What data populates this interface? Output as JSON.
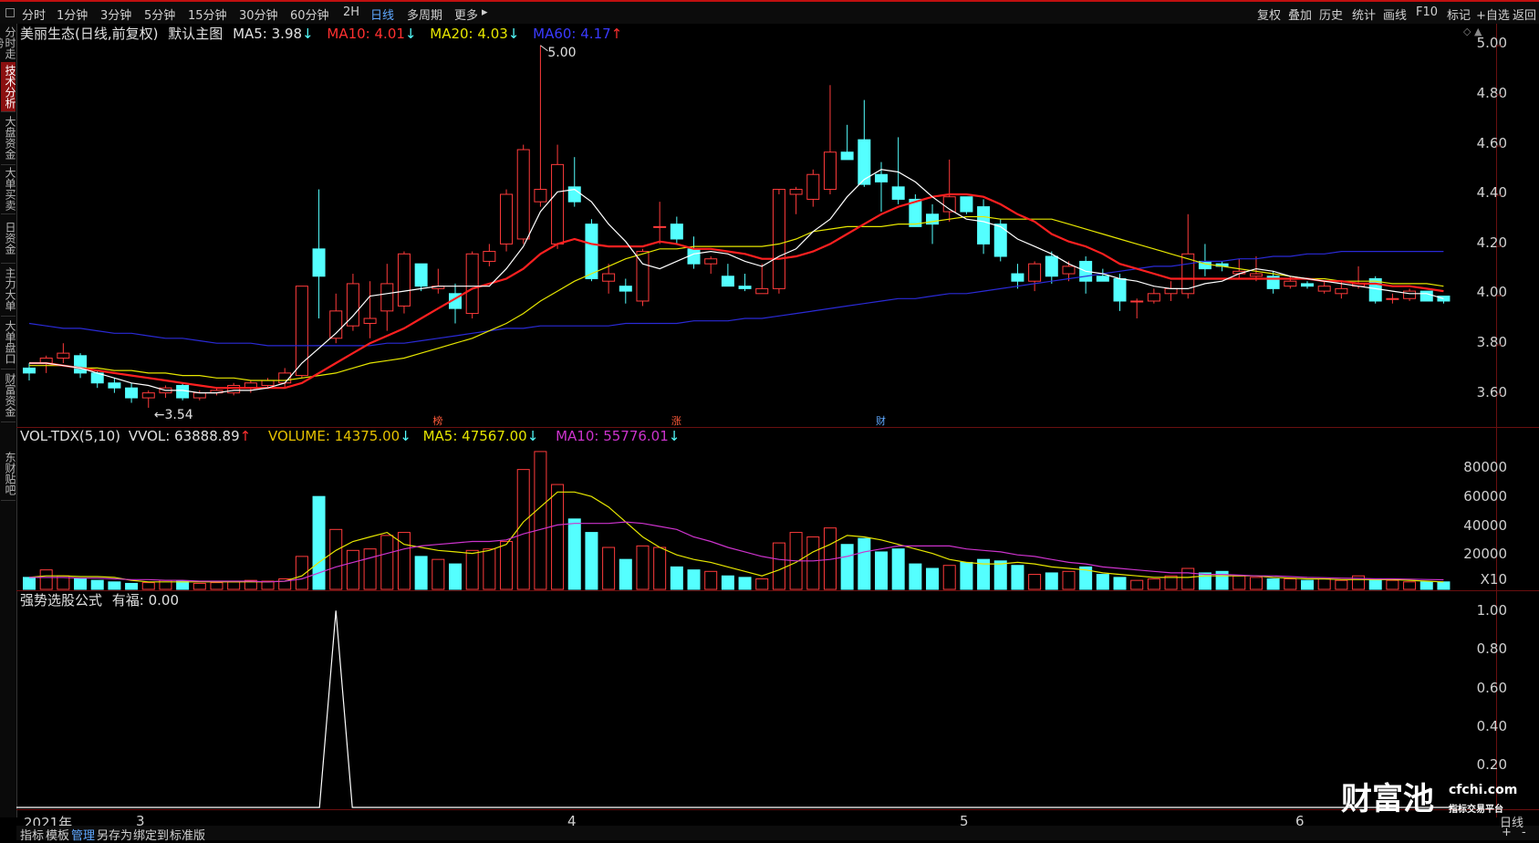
{
  "toolbar": {
    "periods": [
      "分时",
      "1分钟",
      "3分钟",
      "5分钟",
      "15分钟",
      "30分钟",
      "60分钟",
      "2H",
      "日线",
      "多周期",
      "更多"
    ],
    "more_arrow": "▸",
    "active_period": "日线",
    "right_tools": [
      "复权",
      "叠加",
      "历史",
      "统计",
      "画线",
      "F10",
      "标记",
      "+自选",
      "返回"
    ]
  },
  "left_tabs": [
    "分时走势",
    "技术分析",
    "大盘资金",
    "大单买卖",
    "日资金",
    "主力大单",
    "大单盘口",
    "财富资金",
    "东财贴吧"
  ],
  "active_left_tab": "技术分析",
  "main_panel": {
    "stock": "美丽生态(日线,前复权)",
    "indicator": "默认主图",
    "ma5": "MA5: 3.98",
    "ma5_arrow": "↓",
    "ma10": "MA10: 4.01",
    "ma10_arrow": "↓",
    "ma20": "MA20: 4.03",
    "ma20_arrow": "↓",
    "ma60": "MA60: 4.17",
    "ma60_arrow": "↑",
    "controls": "◇ ▲",
    "price_axis": [
      "5.00",
      "4.80",
      "4.60",
      "4.40",
      "4.20",
      "4.00",
      "3.80",
      "3.60"
    ],
    "high_annotation": "5.00",
    "low_annotation": "3.54",
    "markers": [
      "榜",
      "涨",
      "财"
    ]
  },
  "volume_panel": {
    "indicator": "VOL-TDX(5,10)",
    "vvol": "VVOL: 63888.89",
    "vvol_arrow": "↑",
    "volume": "VOLUME: 14375.00",
    "volume_arrow": "↓",
    "ma5": "MA5: 47567.00",
    "ma5_arrow": "↓",
    "ma10": "MA10: 55776.01",
    "ma10_arrow": "↓",
    "axis": [
      "80000",
      "60000",
      "40000",
      "20000"
    ],
    "unit": "X10"
  },
  "signal_panel": {
    "indicator": "强势选股公式",
    "value": "有福: 0.00",
    "axis": [
      "1.00",
      "0.80",
      "0.60",
      "0.40",
      "0.20"
    ]
  },
  "dates": [
    "2021年",
    "3",
    "4",
    "5",
    "6"
  ],
  "bottom_bar": {
    "items": [
      "指标",
      "模板",
      "管理",
      "另存为",
      "绑定到",
      "标准版"
    ],
    "active": "管理",
    "period": "日线",
    "zoom": [
      "+",
      "-"
    ]
  },
  "watermark": {
    "brand": "财富池",
    "site": "cfchi.com",
    "tagline": "指标交易平台"
  },
  "colors": {
    "up": "#ff3b3b",
    "down": "#54ffff",
    "ma5": "#ffffff",
    "ma10": "#ff2020",
    "ma20": "#e6e600",
    "ma60": "#2a2ad6",
    "vol_ma10": "#cc33cc",
    "grid_border": "#6a0f0f"
  },
  "chart_data": [
    {
      "type": "candlestick",
      "title": "美丽生态(日线,前复权)",
      "ylim": [
        3.47,
        5.08
      ],
      "candles": [
        [
          3.7,
          3.72,
          3.65,
          3.68
        ],
        [
          3.72,
          3.75,
          3.68,
          3.74
        ],
        [
          3.74,
          3.8,
          3.72,
          3.76
        ],
        [
          3.75,
          3.76,
          3.66,
          3.68
        ],
        [
          3.68,
          3.69,
          3.62,
          3.64
        ],
        [
          3.64,
          3.66,
          3.6,
          3.62
        ],
        [
          3.62,
          3.64,
          3.56,
          3.58
        ],
        [
          3.58,
          3.61,
          3.54,
          3.6
        ],
        [
          3.6,
          3.63,
          3.58,
          3.62
        ],
        [
          3.63,
          3.64,
          3.57,
          3.58
        ],
        [
          3.58,
          3.61,
          3.57,
          3.6
        ],
        [
          3.6,
          3.62,
          3.59,
          3.61
        ],
        [
          3.6,
          3.64,
          3.59,
          3.63
        ],
        [
          3.62,
          3.65,
          3.6,
          3.64
        ],
        [
          3.63,
          3.66,
          3.62,
          3.65
        ],
        [
          3.64,
          3.7,
          3.62,
          3.68
        ],
        [
          3.67,
          4.03,
          3.66,
          4.03
        ],
        [
          4.18,
          4.42,
          3.9,
          4.07
        ],
        [
          3.82,
          4.0,
          3.8,
          3.93
        ],
        [
          3.87,
          4.08,
          3.85,
          4.04
        ],
        [
          3.88,
          4.05,
          3.82,
          3.9
        ],
        [
          3.93,
          4.12,
          3.85,
          4.04
        ],
        [
          3.95,
          4.17,
          3.92,
          4.16
        ],
        [
          4.12,
          4.12,
          4.01,
          4.03
        ],
        [
          4.02,
          4.1,
          4.0,
          4.03
        ],
        [
          4.0,
          4.04,
          3.88,
          3.94
        ],
        [
          3.92,
          4.17,
          3.9,
          4.16
        ],
        [
          4.13,
          4.2,
          4.11,
          4.17
        ],
        [
          4.2,
          4.42,
          4.17,
          4.4
        ],
        [
          4.22,
          4.6,
          4.2,
          4.58
        ],
        [
          4.37,
          5.0,
          4.35,
          4.42
        ],
        [
          4.2,
          4.6,
          4.18,
          4.52
        ],
        [
          4.43,
          4.55,
          4.35,
          4.37
        ],
        [
          4.28,
          4.3,
          4.05,
          4.06
        ],
        [
          4.05,
          4.12,
          4.0,
          4.08
        ],
        [
          4.03,
          4.06,
          3.96,
          4.01
        ],
        [
          3.97,
          4.18,
          3.95,
          4.17
        ],
        [
          4.27,
          4.37,
          4.2,
          4.27
        ],
        [
          4.28,
          4.31,
          4.2,
          4.22
        ],
        [
          4.18,
          4.23,
          4.1,
          4.12
        ],
        [
          4.12,
          4.15,
          4.08,
          4.14
        ],
        [
          4.07,
          4.12,
          4.03,
          4.03
        ],
        [
          4.03,
          4.08,
          4.01,
          4.02
        ],
        [
          4.0,
          4.12,
          4.0,
          4.02
        ],
        [
          4.02,
          4.4,
          4.0,
          4.42
        ],
        [
          4.4,
          4.43,
          4.32,
          4.42
        ],
        [
          4.38,
          4.5,
          4.35,
          4.48
        ],
        [
          4.42,
          4.84,
          4.4,
          4.57
        ],
        [
          4.57,
          4.68,
          4.55,
          4.54
        ],
        [
          4.62,
          4.78,
          4.43,
          4.44
        ],
        [
          4.48,
          4.53,
          4.33,
          4.45
        ],
        [
          4.43,
          4.63,
          4.36,
          4.38
        ],
        [
          4.38,
          4.4,
          4.28,
          4.27
        ],
        [
          4.32,
          4.36,
          4.2,
          4.28
        ],
        [
          4.33,
          4.54,
          4.29,
          4.39
        ],
        [
          4.39,
          4.38,
          4.32,
          4.33
        ],
        [
          4.35,
          4.38,
          4.16,
          4.2
        ],
        [
          4.28,
          4.3,
          4.13,
          4.15
        ],
        [
          4.08,
          4.12,
          4.02,
          4.05
        ],
        [
          4.05,
          4.13,
          4.01,
          4.12
        ],
        [
          4.15,
          4.17,
          4.04,
          4.07
        ],
        [
          4.08,
          4.13,
          4.05,
          4.11
        ],
        [
          4.13,
          4.15,
          4.0,
          4.05
        ],
        [
          4.07,
          4.1,
          4.05,
          4.05
        ],
        [
          4.06,
          4.08,
          3.93,
          3.97
        ],
        [
          3.97,
          3.98,
          3.9,
          3.97
        ],
        [
          3.97,
          4.02,
          3.96,
          4.0
        ],
        [
          4.0,
          4.05,
          3.97,
          4.02
        ],
        [
          4.0,
          4.32,
          3.98,
          4.16
        ],
        [
          4.13,
          4.2,
          4.07,
          4.1
        ],
        [
          4.12,
          4.13,
          4.09,
          4.11
        ],
        [
          4.08,
          4.14,
          4.06,
          4.09
        ],
        [
          4.07,
          4.15,
          4.05,
          4.08
        ],
        [
          4.07,
          4.09,
          4.0,
          4.02
        ],
        [
          4.03,
          4.07,
          4.02,
          4.05
        ],
        [
          4.04,
          4.05,
          4.02,
          4.03
        ],
        [
          4.01,
          4.05,
          4.0,
          4.03
        ],
        [
          4.0,
          4.05,
          3.98,
          4.02
        ],
        [
          4.03,
          4.11,
          4.02,
          4.04
        ],
        [
          4.06,
          4.07,
          3.96,
          3.97
        ],
        [
          3.98,
          4.0,
          3.96,
          3.98
        ],
        [
          3.98,
          4.02,
          3.97,
          4.01
        ],
        [
          4.01,
          4.01,
          3.97,
          3.97
        ],
        [
          3.99,
          3.99,
          3.96,
          3.97
        ]
      ],
      "ma5": [
        3.72,
        3.72,
        3.71,
        3.7,
        3.68,
        3.66,
        3.64,
        3.63,
        3.61,
        3.61,
        3.6,
        3.6,
        3.61,
        3.61,
        3.62,
        3.64,
        3.72,
        3.78,
        3.84,
        3.91,
        3.99,
        4.0,
        4.01,
        4.02,
        4.03,
        4.03,
        4.03,
        4.03,
        4.1,
        4.19,
        4.33,
        4.41,
        4.42,
        4.37,
        4.28,
        4.21,
        4.12,
        4.1,
        4.13,
        4.16,
        4.17,
        4.16,
        4.13,
        4.11,
        4.15,
        4.18,
        4.25,
        4.3,
        4.39,
        4.46,
        4.5,
        4.49,
        4.45,
        4.39,
        4.34,
        4.3,
        4.29,
        4.27,
        4.22,
        4.19,
        4.16,
        4.12,
        4.09,
        4.08,
        4.06,
        4.05,
        4.03,
        4.02,
        4.02,
        4.04,
        4.05,
        4.08,
        4.1,
        4.09,
        4.07,
        4.06,
        4.05,
        4.04,
        4.03,
        4.02,
        4.01,
        4.0,
        4.0,
        3.98
      ],
      "ma10": [
        3.72,
        3.72,
        3.71,
        3.7,
        3.69,
        3.68,
        3.67,
        3.66,
        3.65,
        3.64,
        3.63,
        3.62,
        3.62,
        3.62,
        3.62,
        3.62,
        3.64,
        3.68,
        3.72,
        3.76,
        3.8,
        3.83,
        3.86,
        3.9,
        3.94,
        3.98,
        4.02,
        4.04,
        4.06,
        4.1,
        4.16,
        4.2,
        4.22,
        4.2,
        4.19,
        4.19,
        4.19,
        4.21,
        4.2,
        4.18,
        4.18,
        4.17,
        4.16,
        4.14,
        4.14,
        4.15,
        4.17,
        4.2,
        4.24,
        4.28,
        4.32,
        4.35,
        4.37,
        4.39,
        4.4,
        4.4,
        4.39,
        4.36,
        4.32,
        4.29,
        4.24,
        4.21,
        4.19,
        4.16,
        4.12,
        4.1,
        4.08,
        4.06,
        4.06,
        4.06,
        4.06,
        4.06,
        4.06,
        4.06,
        4.06,
        4.06,
        4.05,
        4.05,
        4.04,
        4.04,
        4.03,
        4.03,
        4.02,
        4.01
      ],
      "ma20": [
        3.71,
        3.71,
        3.71,
        3.7,
        3.7,
        3.69,
        3.69,
        3.68,
        3.68,
        3.67,
        3.67,
        3.66,
        3.66,
        3.65,
        3.65,
        3.65,
        3.66,
        3.67,
        3.68,
        3.7,
        3.72,
        3.73,
        3.74,
        3.76,
        3.78,
        3.8,
        3.82,
        3.85,
        3.88,
        3.92,
        3.97,
        4.01,
        4.05,
        4.08,
        4.11,
        4.14,
        4.16,
        4.18,
        4.18,
        4.19,
        4.19,
        4.19,
        4.19,
        4.19,
        4.2,
        4.22,
        4.25,
        4.26,
        4.27,
        4.27,
        4.27,
        4.28,
        4.28,
        4.29,
        4.3,
        4.31,
        4.31,
        4.3,
        4.3,
        4.3,
        4.3,
        4.28,
        4.26,
        4.24,
        4.22,
        4.2,
        4.18,
        4.16,
        4.14,
        4.12,
        4.11,
        4.1,
        4.09,
        4.08,
        4.07,
        4.06,
        4.06,
        4.05,
        4.05,
        4.05,
        4.04,
        4.04,
        4.04,
        4.03
      ],
      "ma60": [
        3.88,
        3.87,
        3.86,
        3.86,
        3.85,
        3.84,
        3.84,
        3.83,
        3.82,
        3.82,
        3.81,
        3.8,
        3.8,
        3.8,
        3.79,
        3.79,
        3.79,
        3.79,
        3.79,
        3.79,
        3.79,
        3.8,
        3.8,
        3.81,
        3.82,
        3.83,
        3.84,
        3.85,
        3.86,
        3.86,
        3.87,
        3.87,
        3.87,
        3.87,
        3.87,
        3.88,
        3.88,
        3.88,
        3.88,
        3.89,
        3.89,
        3.89,
        3.9,
        3.9,
        3.91,
        3.92,
        3.93,
        3.94,
        3.95,
        3.96,
        3.97,
        3.98,
        3.98,
        3.99,
        4.0,
        4.0,
        4.01,
        4.02,
        4.03,
        4.04,
        4.05,
        4.06,
        4.07,
        4.08,
        4.09,
        4.1,
        4.11,
        4.11,
        4.12,
        4.13,
        4.13,
        4.14,
        4.14,
        4.15,
        4.15,
        4.16,
        4.16,
        4.17,
        4.17,
        4.17,
        4.17,
        4.17,
        4.17,
        4.17
      ]
    },
    {
      "type": "bar",
      "title": "VOL-TDX(5,10)",
      "ylim": [
        0,
        95000
      ],
      "volume": [
        8000,
        13000,
        9000,
        7000,
        6000,
        5000,
        4000,
        4500,
        6000,
        5500,
        4000,
        4500,
        5000,
        6000,
        5500,
        7000,
        22000,
        62000,
        40000,
        26000,
        27000,
        36000,
        38000,
        22000,
        20000,
        17000,
        26000,
        27000,
        32000,
        80000,
        92000,
        70000,
        47000,
        38000,
        28000,
        20000,
        29000,
        28000,
        15000,
        13000,
        12000,
        9000,
        8000,
        7000,
        31000,
        38000,
        35000,
        41000,
        30000,
        34000,
        25000,
        27000,
        17000,
        14000,
        16000,
        18000,
        20000,
        19000,
        16000,
        10000,
        11000,
        12000,
        15000,
        10000,
        8000,
        6000,
        7000,
        9000,
        14000,
        11000,
        12000,
        9000,
        8000,
        7000,
        7000,
        6000,
        7000,
        6000,
        9000,
        7000,
        6000,
        5000,
        5000,
        5000
      ],
      "ma5": [
        8000,
        9000,
        9000,
        8500,
        8500,
        8000,
        6000,
        5000,
        5000,
        5000,
        5000,
        5000,
        5000,
        5000,
        5000,
        5500,
        9000,
        18000,
        26000,
        32000,
        35000,
        38000,
        30000,
        28000,
        26000,
        25000,
        24000,
        26000,
        30000,
        45000,
        55000,
        65000,
        65000,
        62000,
        55000,
        45000,
        35000,
        28000,
        23000,
        20000,
        18000,
        15000,
        12000,
        9000,
        13000,
        18000,
        25000,
        30000,
        36000,
        35000,
        33000,
        30000,
        27000,
        24000,
        20000,
        18000,
        17000,
        17000,
        18000,
        17000,
        15000,
        14000,
        13000,
        11000,
        10000,
        9000,
        8000,
        8000,
        8000,
        9000,
        9000,
        9000,
        9000,
        8000,
        7500,
        7000,
        7000,
        6500,
        6500,
        6500,
        6500,
        6000,
        5500,
        5000
      ],
      "ma10": [
        8000,
        8000,
        8000,
        7500,
        7500,
        7000,
        6500,
        6500,
        6000,
        6000,
        5500,
        5500,
        5500,
        5500,
        5000,
        5500,
        7000,
        11000,
        15000,
        18000,
        21000,
        24000,
        27000,
        29000,
        30000,
        31000,
        32000,
        32000,
        33000,
        37000,
        40000,
        43000,
        44000,
        44000,
        44000,
        45000,
        44000,
        42000,
        40000,
        35000,
        32000,
        28000,
        25000,
        22000,
        20000,
        19000,
        19000,
        20000,
        22000,
        25000,
        27000,
        29000,
        29000,
        29000,
        29000,
        27000,
        26000,
        25000,
        23000,
        22000,
        20000,
        18000,
        17000,
        15000,
        14000,
        13000,
        12000,
        11000,
        11000,
        10000,
        10000,
        9500,
        9000,
        9000,
        8500,
        8000,
        7800,
        7500,
        7300,
        7000,
        7000,
        6800,
        6600,
        6400
      ]
    },
    {
      "type": "line",
      "title": "强势选股公式",
      "ylim": [
        0,
        1.08
      ],
      "signal_index": 18,
      "signal_value": 1.0
    }
  ]
}
